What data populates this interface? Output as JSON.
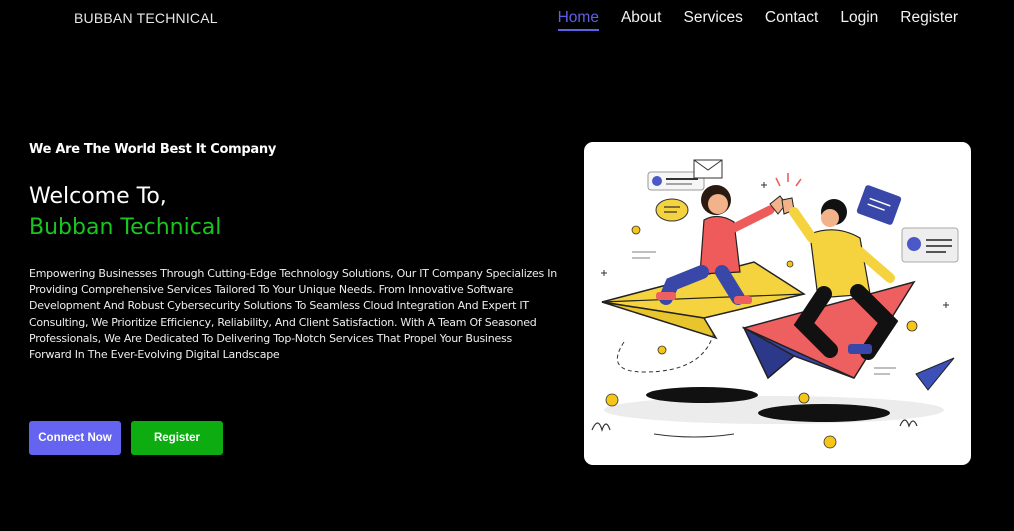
{
  "header": {
    "brand": "BUBBAN TECHNICAL",
    "nav": [
      {
        "label": "Home",
        "active": true
      },
      {
        "label": "About",
        "active": false
      },
      {
        "label": "Services",
        "active": false
      },
      {
        "label": "Contact",
        "active": false
      },
      {
        "label": "Login",
        "active": false
      },
      {
        "label": "Register",
        "active": false
      }
    ]
  },
  "hero": {
    "tagline": "We Are The World Best It Company",
    "welcome": "Welcome To,",
    "company": "Bubban Technical",
    "description": "Empowering Businesses Through Cutting-Edge Technology Solutions, Our IT Company Specializes In Providing Comprehensive Services Tailored To Your Unique Needs. From Innovative Software Development And Robust Cybersecurity Solutions To Seamless Cloud Integration And Expert IT Consulting, We Prioritize Efficiency, Reliability, And Client Satisfaction. With A Team Of Seasoned Professionals, We Are Dedicated To Delivering Top-Notch Services That Propel Your Business Forward In The Ever-Evolving Digital Landscape",
    "buttons": {
      "connect": "Connect Now",
      "register": "Register"
    }
  },
  "colors": {
    "background": "#000000",
    "accent_blue": "#6464f0",
    "accent_green": "#19c51f",
    "register_green": "#0dad12",
    "nav_active": "#5f5fe6"
  },
  "illustration": {
    "icon": "teamwork-high-five-paper-plane-illustration"
  }
}
